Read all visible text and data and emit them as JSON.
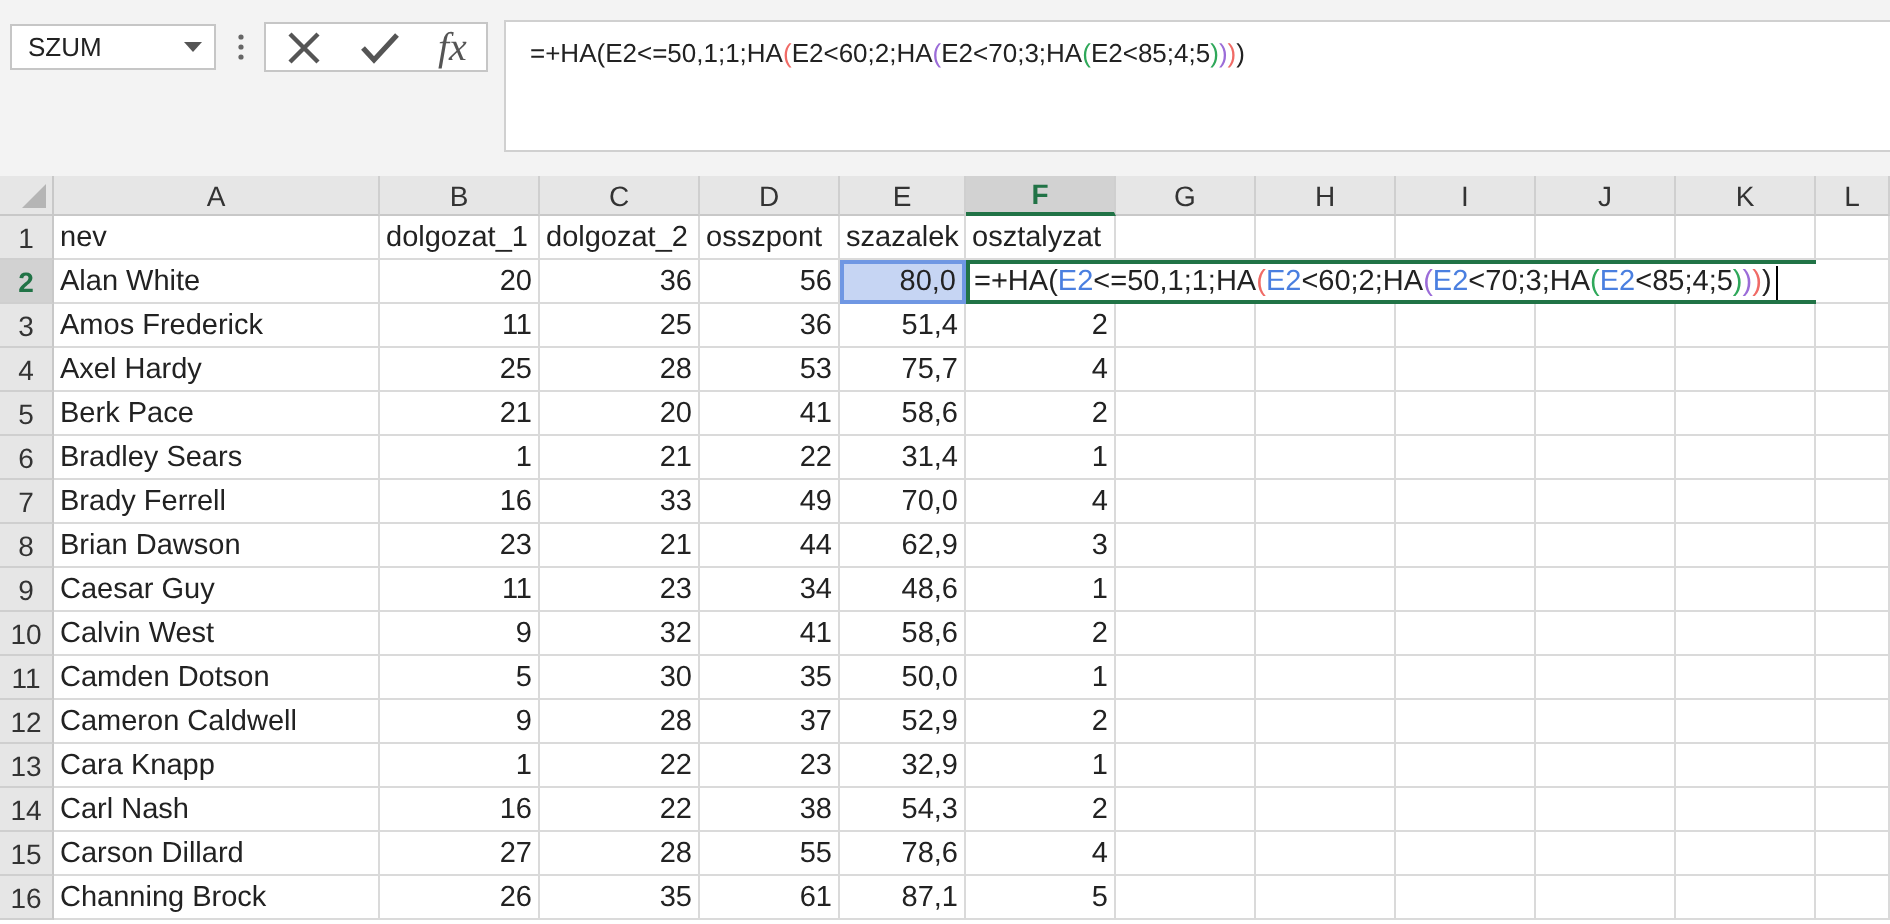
{
  "name_box": {
    "value": "SZUM"
  },
  "formula_bar": {
    "function_label": "fx",
    "segments": [
      {
        "text": "=+HA(E2<=50,1;1;HA",
        "color": "#222222"
      },
      {
        "text": "(",
        "color": "#f06b66"
      },
      {
        "text": "E2<60;2;HA",
        "color": "#222222"
      },
      {
        "text": "(",
        "color": "#9b6cd8"
      },
      {
        "text": "E2<70;3;HA",
        "color": "#222222"
      },
      {
        "text": "(",
        "color": "#2fa85a"
      },
      {
        "text": "E2<85;4;5",
        "color": "#222222"
      },
      {
        "text": ")",
        "color": "#2fa85a"
      },
      {
        "text": ")",
        "color": "#9b6cd8"
      },
      {
        "text": ")",
        "color": "#f06b66"
      },
      {
        "text": ")",
        "color": "#222222"
      }
    ]
  },
  "columns": [
    {
      "label": "A",
      "selected": false
    },
    {
      "label": "B",
      "selected": false
    },
    {
      "label": "C",
      "selected": false
    },
    {
      "label": "D",
      "selected": false
    },
    {
      "label": "E",
      "selected": false
    },
    {
      "label": "F",
      "selected": true
    },
    {
      "label": "G",
      "selected": false
    },
    {
      "label": "H",
      "selected": false
    },
    {
      "label": "I",
      "selected": false
    },
    {
      "label": "J",
      "selected": false
    },
    {
      "label": "K",
      "selected": false
    },
    {
      "label": "L",
      "selected": false
    }
  ],
  "rows": [
    {
      "number": "1",
      "selected": false,
      "cells": [
        "nev",
        "dolgozat_1",
        "dolgozat_2",
        "osszpont",
        "szazalek",
        "osztalyzat"
      ]
    },
    {
      "number": "2",
      "selected": true,
      "cells": [
        "Alan White",
        "20",
        "36",
        "56",
        "80,0"
      ],
      "referenced_cells": [
        false,
        false,
        false,
        false,
        true
      ],
      "editor": [
        {
          "text": "=+HA(",
          "color": "#222222"
        },
        {
          "text": "E2",
          "color": "#4a7fe0"
        },
        {
          "text": "<=50,1;1;HA",
          "color": "#222222"
        },
        {
          "text": "(",
          "color": "#f06b66"
        },
        {
          "text": "E2",
          "color": "#4a7fe0"
        },
        {
          "text": "<60;2;HA",
          "color": "#222222"
        },
        {
          "text": "(",
          "color": "#9b6cd8"
        },
        {
          "text": "E2",
          "color": "#4a7fe0"
        },
        {
          "text": "<70;3;HA",
          "color": "#222222"
        },
        {
          "text": "(",
          "color": "#2fa85a"
        },
        {
          "text": "E2",
          "color": "#4a7fe0"
        },
        {
          "text": "<85;4;5",
          "color": "#222222"
        },
        {
          "text": ")",
          "color": "#2fa85a"
        },
        {
          "text": ")",
          "color": "#9b6cd8"
        },
        {
          "text": ")",
          "color": "#f06b66"
        },
        {
          "text": ")",
          "color": "#222222"
        }
      ]
    },
    {
      "number": "3",
      "selected": false,
      "cells": [
        "Amos Frederick",
        "11",
        "25",
        "36",
        "51,4",
        "2"
      ]
    },
    {
      "number": "4",
      "selected": false,
      "cells": [
        "Axel Hardy",
        "25",
        "28",
        "53",
        "75,7",
        "4"
      ]
    },
    {
      "number": "5",
      "selected": false,
      "cells": [
        "Berk Pace",
        "21",
        "20",
        "41",
        "58,6",
        "2"
      ]
    },
    {
      "number": "6",
      "selected": false,
      "cells": [
        "Bradley Sears",
        "1",
        "21",
        "22",
        "31,4",
        "1"
      ]
    },
    {
      "number": "7",
      "selected": false,
      "cells": [
        "Brady Ferrell",
        "16",
        "33",
        "49",
        "70,0",
        "4"
      ]
    },
    {
      "number": "8",
      "selected": false,
      "cells": [
        "Brian Dawson",
        "23",
        "21",
        "44",
        "62,9",
        "3"
      ]
    },
    {
      "number": "9",
      "selected": false,
      "cells": [
        "Caesar Guy",
        "11",
        "23",
        "34",
        "48,6",
        "1"
      ]
    },
    {
      "number": "10",
      "selected": false,
      "cells": [
        "Calvin West",
        "9",
        "32",
        "41",
        "58,6",
        "2"
      ]
    },
    {
      "number": "11",
      "selected": false,
      "cells": [
        "Camden Dotson",
        "5",
        "30",
        "35",
        "50,0",
        "1"
      ]
    },
    {
      "number": "12",
      "selected": false,
      "cells": [
        "Cameron Caldwell",
        "9",
        "28",
        "37",
        "52,9",
        "2"
      ]
    },
    {
      "number": "13",
      "selected": false,
      "cells": [
        "Cara Knapp",
        "1",
        "22",
        "23",
        "32,9",
        "1"
      ]
    },
    {
      "number": "14",
      "selected": false,
      "cells": [
        "Carl Nash",
        "16",
        "22",
        "38",
        "54,3",
        "2"
      ]
    },
    {
      "number": "15",
      "selected": false,
      "cells": [
        "Carson Dillard",
        "27",
        "28",
        "55",
        "78,6",
        "4"
      ]
    },
    {
      "number": "16",
      "selected": false,
      "cells": [
        "Channing Brock",
        "26",
        "35",
        "61",
        "87,1",
        "5"
      ]
    }
  ]
}
